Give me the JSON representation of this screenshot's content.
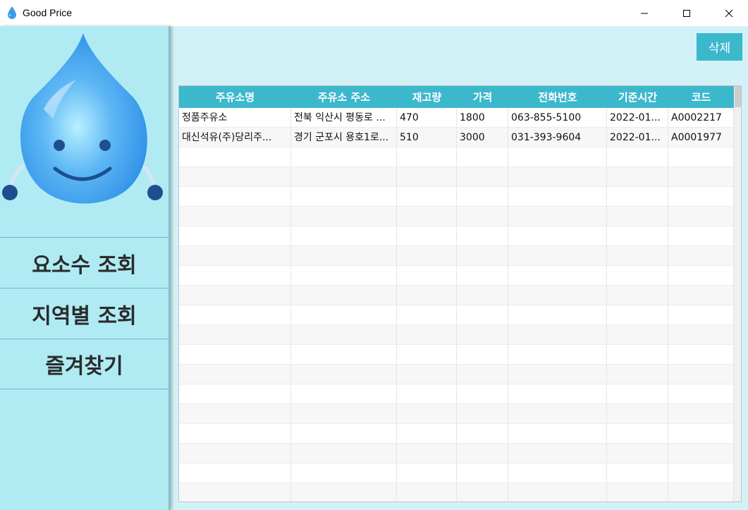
{
  "window": {
    "title": "Good Price"
  },
  "sidebar": {
    "menu": [
      {
        "label": "요소수 조회"
      },
      {
        "label": "지역별 조회"
      },
      {
        "label": "즐겨찾기"
      }
    ]
  },
  "toolbar": {
    "delete_label": "삭제"
  },
  "table": {
    "headers": [
      "주유소명",
      "주유소 주소",
      "재고량",
      "가격",
      "전화번호",
      "기준시간",
      "코드"
    ],
    "rows": [
      [
        "정품주유소",
        "전북 익산시 평동로 ...",
        "470",
        "1800",
        "063-855-5100",
        "2022-01...",
        "A0002217"
      ],
      [
        "대신석유(주)당리주...",
        "경기 군포시 용호1로...",
        "510",
        "3000",
        "031-393-9604",
        "2022-01...",
        "A0001977"
      ]
    ]
  },
  "colors": {
    "accent": "#3cb8cd",
    "sidebar": "#b0ebf4",
    "background": "#d3f2f8"
  },
  "icons": {
    "app": "water-drop-icon",
    "logo": "smiling-water-drop-mascot"
  }
}
